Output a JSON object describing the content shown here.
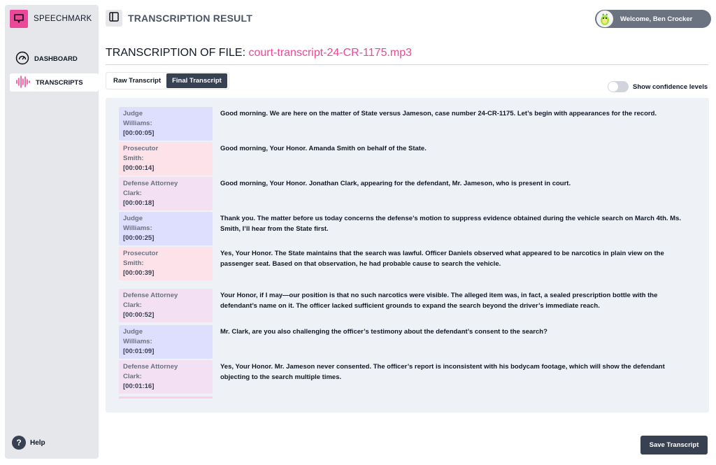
{
  "app": {
    "brand": "SPEECHMARK",
    "brand_color": "#ec4899"
  },
  "sidebar": {
    "items": [
      {
        "label": "DASHBOARD",
        "icon": "dashboard-gauge-icon",
        "active": false
      },
      {
        "label": "TRANSCRIPTS",
        "icon": "waveform-icon",
        "active": true
      }
    ],
    "help_label": "Help"
  },
  "header": {
    "title": "TRANSCRIPTION RESULT",
    "welcome": "Welcome, Ben Crocker"
  },
  "file": {
    "prefix": "TRANSCRIPTION OF FILE:",
    "name": "court-transcript-24-CR-1175.mp3"
  },
  "tabs": [
    {
      "label": "Raw Transcript",
      "active": false
    },
    {
      "label": "Final Transcript",
      "active": true
    }
  ],
  "confidence_toggle": {
    "label": "Show confidence levels",
    "on": false
  },
  "transcript": [
    {
      "role": "judge",
      "speaker_line1": "Judge",
      "speaker_line2": "Williams:",
      "timestamp": "[00:00:05]",
      "text": "Good morning. We are here on the matter of State versus Jameson, case number 24-CR-1175. Let’s begin with appearances for the record."
    },
    {
      "role": "prosecutor",
      "speaker_line1": "Prosecutor",
      "speaker_line2": "Smith:",
      "timestamp": "[00:00:14]",
      "text": "Good morning, Your Honor. Amanda Smith on behalf of the State."
    },
    {
      "role": "defense",
      "speaker_line1": "Defense Attorney",
      "speaker_line2": "Clark:",
      "timestamp": "[00:00:18]",
      "text": "Good morning, Your Honor. Jonathan Clark, appearing for the defendant, Mr. Jameson, who is present in court."
    },
    {
      "role": "judge",
      "speaker_line1": "Judge",
      "speaker_line2": "Williams:",
      "timestamp": "[00:00:25]",
      "text": "Thank you. The matter before us today concerns the defense’s motion to suppress evidence obtained during the vehicle search on March 4th. Ms. Smith, I’ll hear from the State first."
    },
    {
      "role": "prosecutor",
      "speaker_line1": "Prosecutor",
      "speaker_line2": "Smith:",
      "timestamp": "[00:00:39]",
      "text": "Yes, Your Honor. The State maintains that the search was lawful. Officer Daniels observed what appeared to be narcotics in plain view on the passenger seat. Based on that observation, he had probable cause to search the vehicle."
    },
    {
      "role": "defense",
      "speaker_line1": "Defense Attorney",
      "speaker_line2": "Clark:",
      "timestamp": "[00:00:52]",
      "text": "Your Honor, if I may—our position is that no such narcotics were visible. The alleged item was, in fact, a sealed prescription bottle with the defendant’s name on it. The officer lacked sufficient grounds to expand the search beyond the driver’s immediate reach."
    },
    {
      "role": "judge",
      "speaker_line1": "Judge",
      "speaker_line2": "Williams:",
      "timestamp": "[00:01:09]",
      "text": "Mr. Clark, are you also challenging the officer’s testimony about the defendant’s consent to the search?"
    },
    {
      "role": "defense",
      "speaker_line1": "Defense Attorney",
      "speaker_line2": "Clark:",
      "timestamp": "[00:01:16]",
      "text": "Yes, Your Honor. Mr. Jameson never consented. The officer’s report is inconsistent with his bodycam footage, which will show the defendant objecting to the search multiple times."
    }
  ],
  "actions": {
    "save_label": "Save Transcript"
  }
}
